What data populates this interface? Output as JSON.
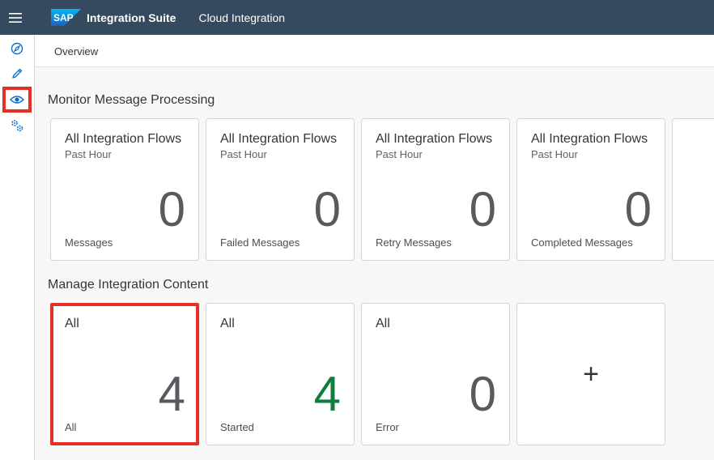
{
  "header": {
    "logo_text": "SAP",
    "app_title": "Integration Suite",
    "app_subtitle": "Cloud Integration"
  },
  "sidebar": {
    "items": [
      {
        "icon": "discover-icon",
        "label": "Discover"
      },
      {
        "icon": "pencil-icon",
        "label": "Design"
      },
      {
        "icon": "eye-icon",
        "label": "Monitor",
        "selected": true
      },
      {
        "icon": "settings-icon",
        "label": "Settings"
      }
    ]
  },
  "breadcrumb": {
    "label": "Overview"
  },
  "monitor": {
    "title": "Monitor Message Processing",
    "tiles": [
      {
        "title": "All Integration Flows",
        "subtitle": "Past Hour",
        "value": "0",
        "footer": "Messages"
      },
      {
        "title": "All Integration Flows",
        "subtitle": "Past Hour",
        "value": "0",
        "footer": "Failed Messages"
      },
      {
        "title": "All Integration Flows",
        "subtitle": "Past Hour",
        "value": "0",
        "footer": "Retry Messages"
      },
      {
        "title": "All Integration Flows",
        "subtitle": "Past Hour",
        "value": "0",
        "footer": "Completed Messages"
      }
    ]
  },
  "manage": {
    "title": "Manage Integration Content",
    "tiles": [
      {
        "title": "All",
        "value": "4",
        "footer": "All"
      },
      {
        "title": "All",
        "value": "4",
        "footer": "Started"
      },
      {
        "title": "All",
        "value": "0",
        "footer": "Error"
      }
    ],
    "add_tile_label": "+"
  },
  "colors": {
    "shell": "#354a5f",
    "highlight": "#e53027",
    "positive": "#107e3e",
    "icon": "#0a6ed1"
  }
}
